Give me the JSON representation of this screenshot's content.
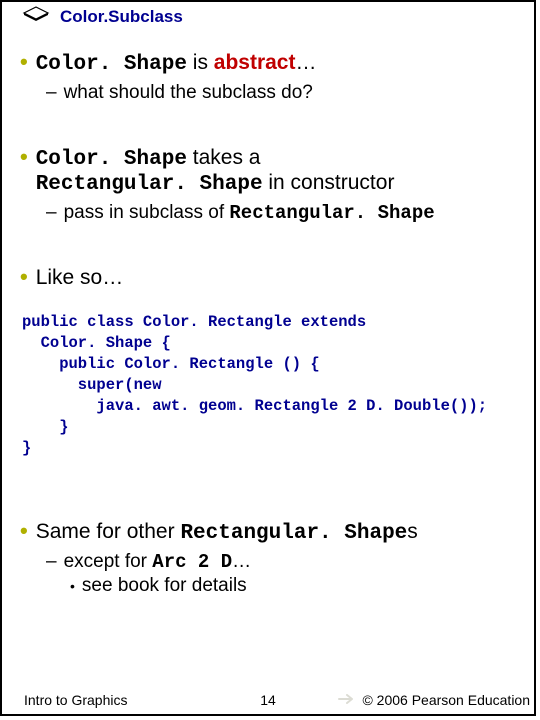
{
  "header": {
    "title": "Color.Subclass"
  },
  "bullets": {
    "b1a_code": "Color. Shape",
    "b1a_text": " is ",
    "b1a_abstract": "abstract",
    "b1a_tail": "…",
    "b1a_sub": "what should the subclass do?",
    "b2_code1": "Color. Shape",
    "b2_mid": " takes a ",
    "b2_code2": "Rectangular. Shape",
    "b2_tail": " in constructor",
    "b2_sub_pre": "pass in subclass of ",
    "b2_sub_code": "Rectangular. Shape",
    "b3_text": "Like so…",
    "b4_pre": "Same for other ",
    "b4_code": "Rectangular. Shape",
    "b4_tail": "s",
    "b4_sub_pre": "except for ",
    "b4_sub_code": "Arc 2 D",
    "b4_sub_tail": "…",
    "b4_sub2": "see book for details"
  },
  "code": "public class Color. Rectangle extends\n  Color. Shape {\n    public Color. Rectangle () {\n      super(new\n        java. awt. geom. Rectangle 2 D. Double());\n    }\n}",
  "footer": {
    "left": "Intro to Graphics",
    "center": "14",
    "right": "© 2006 Pearson Education"
  }
}
